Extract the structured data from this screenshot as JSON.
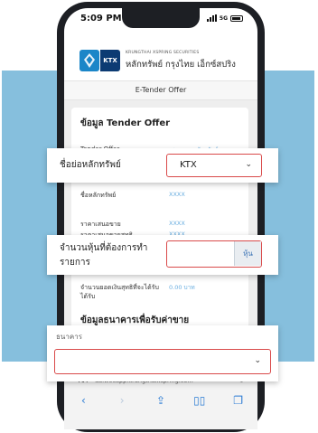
{
  "status": {
    "time": "5:09 PM",
    "network": "5G"
  },
  "brand": {
    "name_en": "KRUNGTHAI XSPRING SECURITIES",
    "name_th": "หลักทรัพย์ กรุงไทย เอ็กซ์สปริง",
    "ktx": "KTX"
  },
  "page": {
    "title": "E-Tender Offer"
  },
  "card": {
    "title": "ข้อมูล Tender Offer",
    "rows": [
      {
        "label": "Tender Offer",
        "value": "เสนอขายหลักทรัพย์"
      },
      {
        "label": "ชื่อหลักทรัพย์",
        "value": "XXXX"
      },
      {
        "label": "ราคาเสนอขาย",
        "value": "XXXX"
      },
      {
        "label": "ราคาเสนอขายสุทธิ",
        "value": "XXXX"
      },
      {
        "label": "จำนวนยอดเงินสุทธิที่จะได้รับ",
        "label2": "ได้รับ",
        "value": "0.00 บาท"
      }
    ],
    "bank_section_title": "ข้อมูลธนาคารเพื่อรับค่าขาย"
  },
  "browser": {
    "aa": "AA",
    "url": "ua.wecapp.krungthaixspring.com"
  },
  "callouts": {
    "symbol": {
      "label": "ชื่อย่อหลักทรัพย์",
      "value": "KTX"
    },
    "quantity": {
      "label_line1": "จำนวนหุ้นที่ต้องการทำ",
      "label_line2": "รายการ",
      "unit": "หุ้น"
    },
    "bank": {
      "label": "ธนาคาร"
    }
  },
  "icons": {
    "chevron": "chevron-down-icon",
    "back": "back-icon",
    "forward": "forward-icon",
    "share": "share-icon",
    "bookmarks": "bookmarks-icon",
    "tabs": "tabs-icon"
  },
  "colors": {
    "background_band": "#86bfdd",
    "accent": "#1b86c8",
    "error_border": "#d94a4a"
  }
}
